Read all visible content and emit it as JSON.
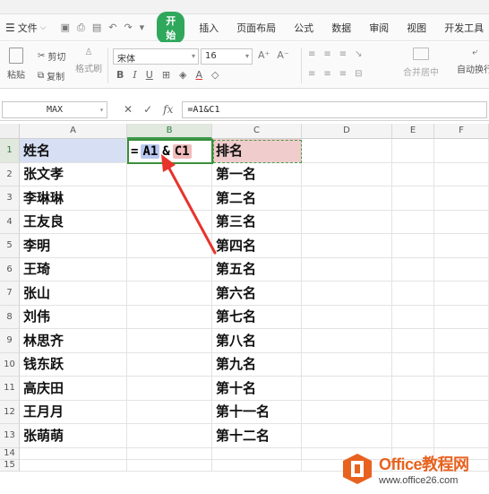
{
  "menu": {
    "file": "文件",
    "start": "开始",
    "items": [
      "插入",
      "页面布局",
      "公式",
      "数据",
      "审阅",
      "视图",
      "开发工具"
    ]
  },
  "ribbon": {
    "paste": "粘贴",
    "cut": "剪切",
    "copy": "复制",
    "format_painter": "格式刷",
    "font_name": "宋体",
    "font_size": "16",
    "merge": "合并居中",
    "wrap": "自动换行"
  },
  "formula_bar": {
    "name_box": "MAX",
    "formula": "=A1&C1",
    "fx": "fx"
  },
  "columns": [
    "A",
    "B",
    "C",
    "D",
    "E",
    "F"
  ],
  "rows": [
    "1",
    "2",
    "3",
    "4",
    "5",
    "6",
    "7",
    "8",
    "9",
    "10",
    "11",
    "12",
    "13",
    "14",
    "15"
  ],
  "cells": {
    "A": [
      "姓名",
      "张文孝",
      "李琳琳",
      "王友良",
      "李明",
      "王琦",
      "张山",
      "刘伟",
      "林思齐",
      "钱东跃",
      "高庆田",
      "王月月",
      "张萌萌"
    ],
    "C": [
      "排名",
      "第一名",
      "第二名",
      "第三名",
      "第四名",
      "第五名",
      "第六名",
      "第七名",
      "第八名",
      "第九名",
      "第十名",
      "第十一名",
      "第十二名"
    ]
  },
  "b1_edit": {
    "eq": "=",
    "ref_a": "A1",
    "amp": "&",
    "ref_c": "C1"
  },
  "watermark": {
    "brand": "Office教程网",
    "url": "www.office26.com"
  },
  "colors": {
    "accent": "#2fa85c",
    "a1_fill": "#d6dff3",
    "c1_fill": "#f0cccc",
    "arrow": "#e8332a",
    "brand": "#e8621f"
  }
}
